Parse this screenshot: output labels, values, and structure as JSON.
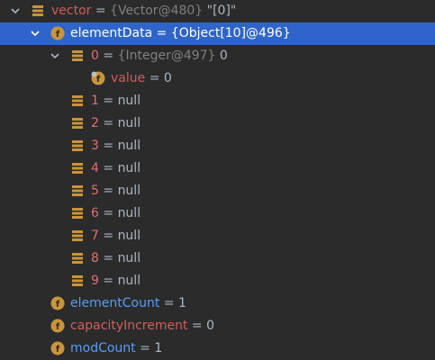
{
  "debugger": {
    "rows": [
      {
        "name": "vector",
        "eq": " = ",
        "ref": "{Vector@480}",
        "val": " \"[0]\"",
        "icon": "local-variable-icon",
        "expanded": true
      },
      {
        "name": "elementData",
        "eq": " = ",
        "ref": "",
        "val": "{Object[10]@496}",
        "icon": "field-icon",
        "expanded": true,
        "selected": true
      },
      {
        "name": "0",
        "eq": " = ",
        "ref": "{Integer@497}",
        "val": " 0",
        "icon": "array-element-icon",
        "expanded": true
      },
      {
        "name": "value",
        "eq": " = ",
        "ref": "",
        "val": "0",
        "icon": "final-field-icon"
      },
      {
        "name": "1",
        "eq": " = ",
        "ref": "",
        "val": "null",
        "icon": "array-element-icon"
      },
      {
        "name": "2",
        "eq": " = ",
        "ref": "",
        "val": "null",
        "icon": "array-element-icon"
      },
      {
        "name": "3",
        "eq": " = ",
        "ref": "",
        "val": "null",
        "icon": "array-element-icon"
      },
      {
        "name": "4",
        "eq": " = ",
        "ref": "",
        "val": "null",
        "icon": "array-element-icon"
      },
      {
        "name": "5",
        "eq": " = ",
        "ref": "",
        "val": "null",
        "icon": "array-element-icon"
      },
      {
        "name": "6",
        "eq": " = ",
        "ref": "",
        "val": "null",
        "icon": "array-element-icon"
      },
      {
        "name": "7",
        "eq": " = ",
        "ref": "",
        "val": "null",
        "icon": "array-element-icon"
      },
      {
        "name": "8",
        "eq": " = ",
        "ref": "",
        "val": "null",
        "icon": "array-element-icon"
      },
      {
        "name": "9",
        "eq": " = ",
        "ref": "",
        "val": "null",
        "icon": "array-element-icon"
      },
      {
        "name": "elementCount",
        "eq": " = ",
        "ref": "",
        "val": "1",
        "icon": "field-icon"
      },
      {
        "name": "capacityIncrement",
        "eq": " = ",
        "ref": "",
        "val": "0",
        "icon": "field-icon"
      },
      {
        "name": "modCount",
        "eq": " = ",
        "ref": "",
        "val": "1",
        "icon": "field-icon"
      }
    ]
  },
  "colors": {
    "background": "#2b2b2b",
    "selection": "#2f65ca",
    "field_icon": "#c9953b",
    "array_icon": "#c9953b"
  }
}
